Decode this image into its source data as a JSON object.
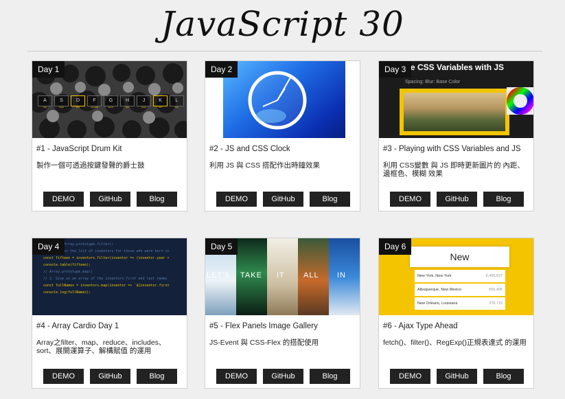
{
  "page": {
    "title": "JavaScript 30"
  },
  "cards": [
    {
      "day": "Day 1",
      "title": "#1 - JavaScript Drum Kit",
      "desc": "製作一個可透過按鍵發聲的爵士鼓",
      "thumb_keys": [
        "A",
        "S",
        "D",
        "F",
        "G",
        "H",
        "J",
        "K",
        "L"
      ],
      "thumb_sounds": [
        "clap",
        "hihat",
        "kick",
        "openhat",
        "boom",
        "ride",
        "snare",
        "tom",
        "tink"
      ]
    },
    {
      "day": "Day 2",
      "title": "#2 - JS and CSS Clock",
      "desc": "利用 JS 與 CSS 搭配作出時鐘效果"
    },
    {
      "day": "Day 3",
      "title": "#3 - Playing with CSS Variables and JS",
      "desc": "利用 CSS變數 與 JS 即時更新圖片的 內距、邊框色、模糊 效果",
      "thumb_heading": "Update CSS Variables with JS",
      "thumb_controls": "Spacing:   Blur:   Base Color"
    },
    {
      "day": "Day 4",
      "title": "#4 - Array Cardio Day 1",
      "desc": "Array之filter、map、reduce、includes、sort、展開運算子、解構賦值 的運用",
      "thumb_code": [
        "Array.prototype.filter()",
        "// 1. Filter the list of inventors for those who were born in",
        "const fifteen = inventors.filter(inventor => (inventor.year >",
        "",
        "console.table(fifteen);",
        "",
        "// Array.prototype.map()",
        "// 2. Give us an array of the inventors first and last names",
        "const fullNames = inventors.map(inventor => `${inventor.first",
        "console.log(fullNames);"
      ]
    },
    {
      "day": "Day 5",
      "title": "#5 - Flex Panels Image Gallery",
      "desc": "JS-Event 與 CSS-Flex 的搭配使用",
      "thumb_words": [
        "LET'S",
        "TAKE",
        "IT",
        "ALL",
        "IN"
      ]
    },
    {
      "day": "Day 6",
      "title": "#6 - Ajax Type Ahead",
      "desc": "fetch()、filter()、RegExp()正規表達式 的運用",
      "thumb_input": "New",
      "thumb_rows": [
        {
          "city": "New York, New York",
          "pop": "8,405,837"
        },
        {
          "city": "Albuquerque, New Mexico",
          "pop": "556,495"
        },
        {
          "city": "New Orleans, Louisiana",
          "pop": "378,715"
        }
      ]
    }
  ],
  "buttons": {
    "demo": "DEMO",
    "github": "GitHub",
    "blog": "Blog"
  },
  "colors": {
    "page_bg": "#efefef",
    "card_bg": "#ffffff",
    "button_bg": "#222222",
    "day_badge_bg": "#111111",
    "accent_yellow": "#f4c400"
  }
}
